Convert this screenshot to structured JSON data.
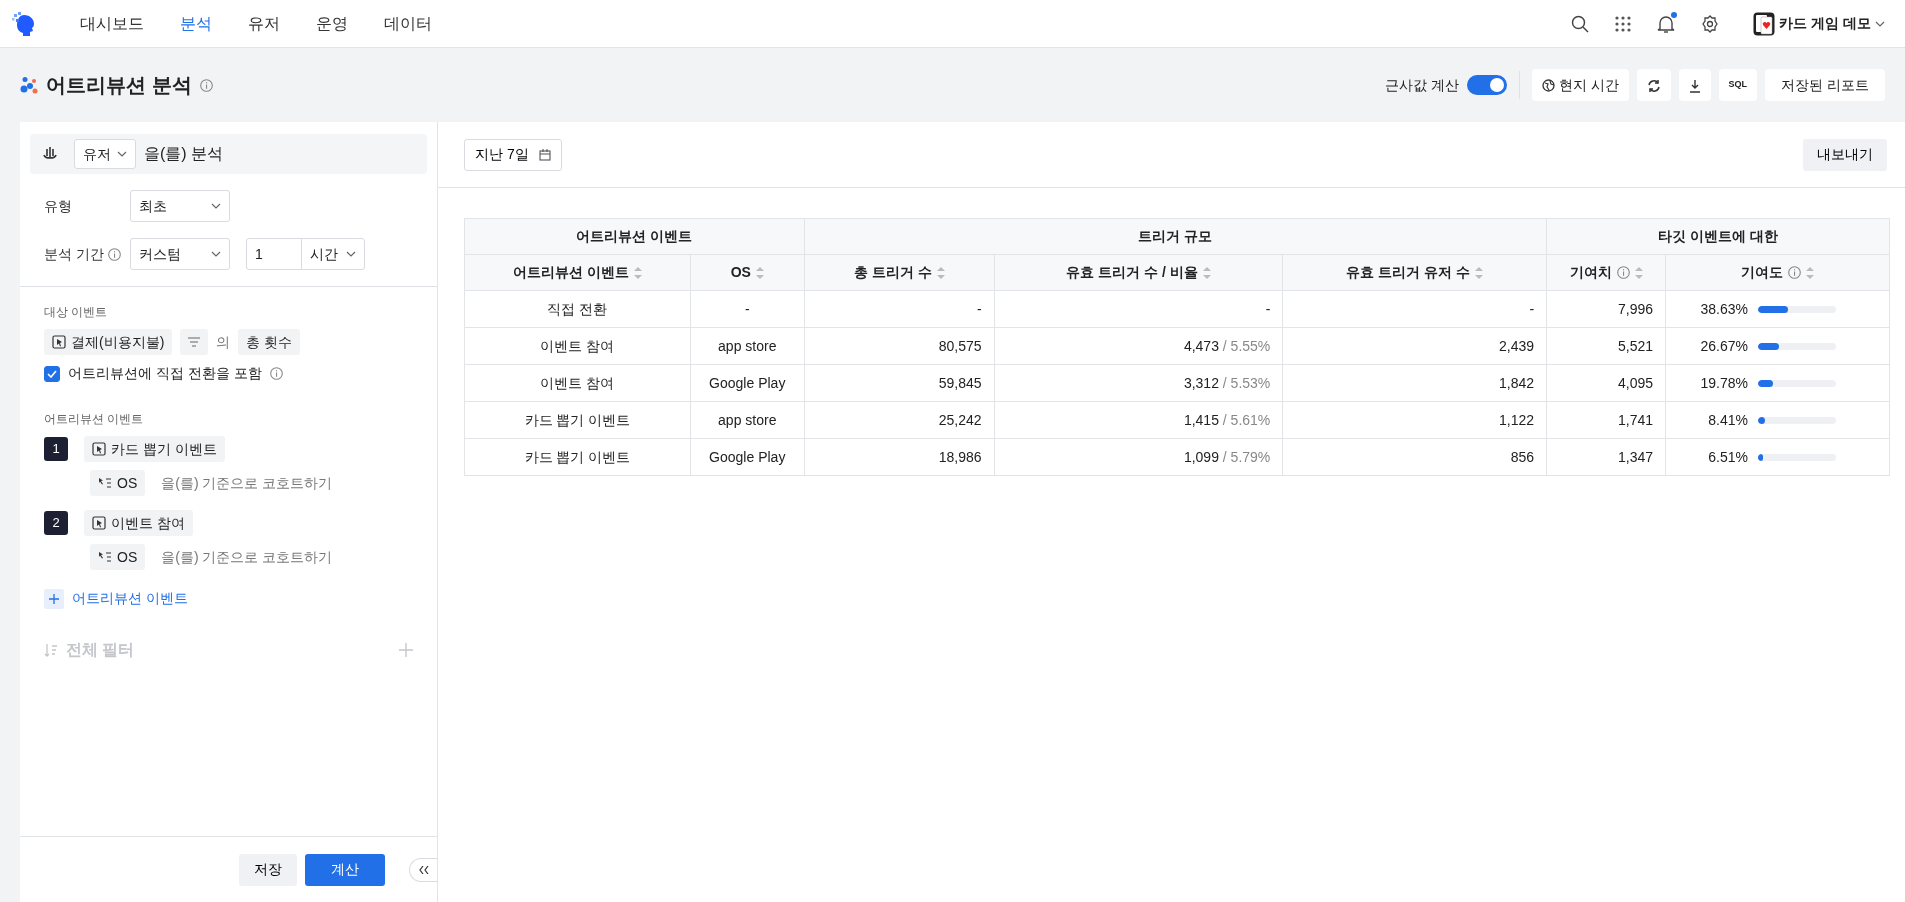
{
  "nav": {
    "items": [
      {
        "label": "대시보드",
        "selected": false
      },
      {
        "label": "분석",
        "selected": true
      },
      {
        "label": "유저",
        "selected": false
      },
      {
        "label": "운영",
        "selected": false
      },
      {
        "label": "데이터",
        "selected": false
      }
    ],
    "notification_dot": true,
    "project": "카드 게임 데모"
  },
  "header": {
    "title": "어트리뷰션 분석",
    "approx_label": "근사값 계산",
    "approx_on": true,
    "local_time": "현지 시간",
    "sql": "SQL",
    "saved_reports": "저장된 리포트"
  },
  "panel": {
    "subject": "유저",
    "subject_suffix": "을(를) 분석",
    "type_label": "유형",
    "type_value": "최초",
    "period_label": "분석 기간",
    "period_value": "커스텀",
    "period_number": "1",
    "period_unit": "시간",
    "target_label": "대상 이벤트",
    "target_event": "결제(비용지불)",
    "target_of": "의",
    "target_metric": "총 횟수",
    "include_direct": {
      "label": "어트리뷰션에 직접 전환을 포함",
      "checked": true
    },
    "attribution_label": "어트리뷰션 이벤트",
    "events": [
      {
        "index": "1",
        "name": "카드 뽑기 이벤트",
        "group_by": "OS",
        "group_suffix": "을(를) 기준으로 코호트하기"
      },
      {
        "index": "2",
        "name": "이벤트 참여",
        "group_by": "OS",
        "group_suffix": "을(를) 기준으로 코호트하기"
      }
    ],
    "add_event": "어트리뷰션 이벤트",
    "filter_label": "전체 필터",
    "save": "저장",
    "calculate": "계산"
  },
  "results": {
    "date_range": "지난 7일",
    "export": "내보내기",
    "table": {
      "groups": [
        {
          "label": "어트리뷰션 이벤트",
          "columns": [
            {
              "label": "어트리뷰션 이벤트",
              "info": false
            },
            {
              "label": "OS",
              "info": false
            }
          ]
        },
        {
          "label": "트리거 규모",
          "columns": [
            {
              "label": "총 트리거 수",
              "info": false
            },
            {
              "label": "유효 트리거 수 / 비율",
              "info": false
            },
            {
              "label": "유효 트리거 유저 수",
              "info": false
            }
          ]
        },
        {
          "label": "타깃 이벤트에 대한",
          "columns": [
            {
              "label": "기여치",
              "info": true
            },
            {
              "label": "기여도",
              "info": true
            }
          ]
        }
      ],
      "rows": [
        {
          "event": "직접 전환",
          "os": "-",
          "total": "-",
          "valid": "-",
          "valid_users": "-",
          "contribution": "7,996",
          "share": "38.63%",
          "level": 0.3863
        },
        {
          "event": "이벤트 참여",
          "os": "app store",
          "total": "80,575",
          "valid": "4,473",
          "valid_rate": "/ 5.55%",
          "valid_users": "2,439",
          "contribution": "5,521",
          "share": "26.67%",
          "level": 0.2667
        },
        {
          "event": "이벤트 참여",
          "os": "Google Play",
          "total": "59,845",
          "valid": "3,312",
          "valid_rate": "/ 5.53%",
          "valid_users": "1,842",
          "contribution": "4,095",
          "share": "19.78%",
          "level": 0.1978
        },
        {
          "event": "카드 뽑기 이벤트",
          "os": "app store",
          "total": "25,242",
          "valid": "1,415",
          "valid_rate": "/ 5.61%",
          "valid_users": "1,122",
          "contribution": "1,741",
          "share": "8.41%",
          "level": 0.0841
        },
        {
          "event": "카드 뽑기 이벤트",
          "os": "Google Play",
          "total": "18,986",
          "valid": "1,099",
          "valid_rate": "/ 5.79%",
          "valid_users": "856",
          "contribution": "1,347",
          "share": "6.51%",
          "level": 0.0651
        }
      ]
    }
  }
}
